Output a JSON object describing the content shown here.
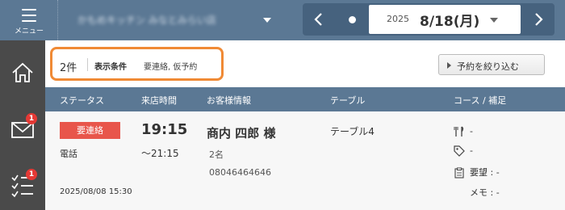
{
  "header": {
    "menu_label": "メニュー",
    "store_name": "かもめキッチン みなとみらい店",
    "date_year": "2025",
    "date_main": "8/18(月)",
    "prev_icon": "chevron-left-icon",
    "next_icon": "chevron-right-icon"
  },
  "sidebar": {
    "items": [
      {
        "icon": "home-icon",
        "badge": ""
      },
      {
        "icon": "mail-icon",
        "badge": "1"
      },
      {
        "icon": "checklist-icon",
        "badge": "1"
      }
    ]
  },
  "filter": {
    "count": "2件",
    "label": "表示条件",
    "value": "要連絡, 仮予約",
    "narrow_button": "予約を絞り込む"
  },
  "table": {
    "headers": [
      "ステータス",
      "来店時間",
      "お客様情報",
      "テーブル",
      "コース / 補足"
    ],
    "rows": [
      {
        "status": "要連絡",
        "via": "電話",
        "created": "2025/08/08 15:30",
        "time_start": "19:15",
        "time_end": "〜21:15",
        "name": "商内 四郎 様",
        "people": "2名",
        "phone": "08046464646",
        "table": "テーブル4",
        "course": "-",
        "option": "-",
        "request": "要望 : -",
        "memo": "メモ : -"
      }
    ]
  },
  "colors": {
    "header_bg": "#5b7894",
    "sidebar_bg": "#4a4a4a",
    "status_red": "#e8564b",
    "highlight_orange": "#f08a35",
    "badge_red": "#e53935"
  }
}
